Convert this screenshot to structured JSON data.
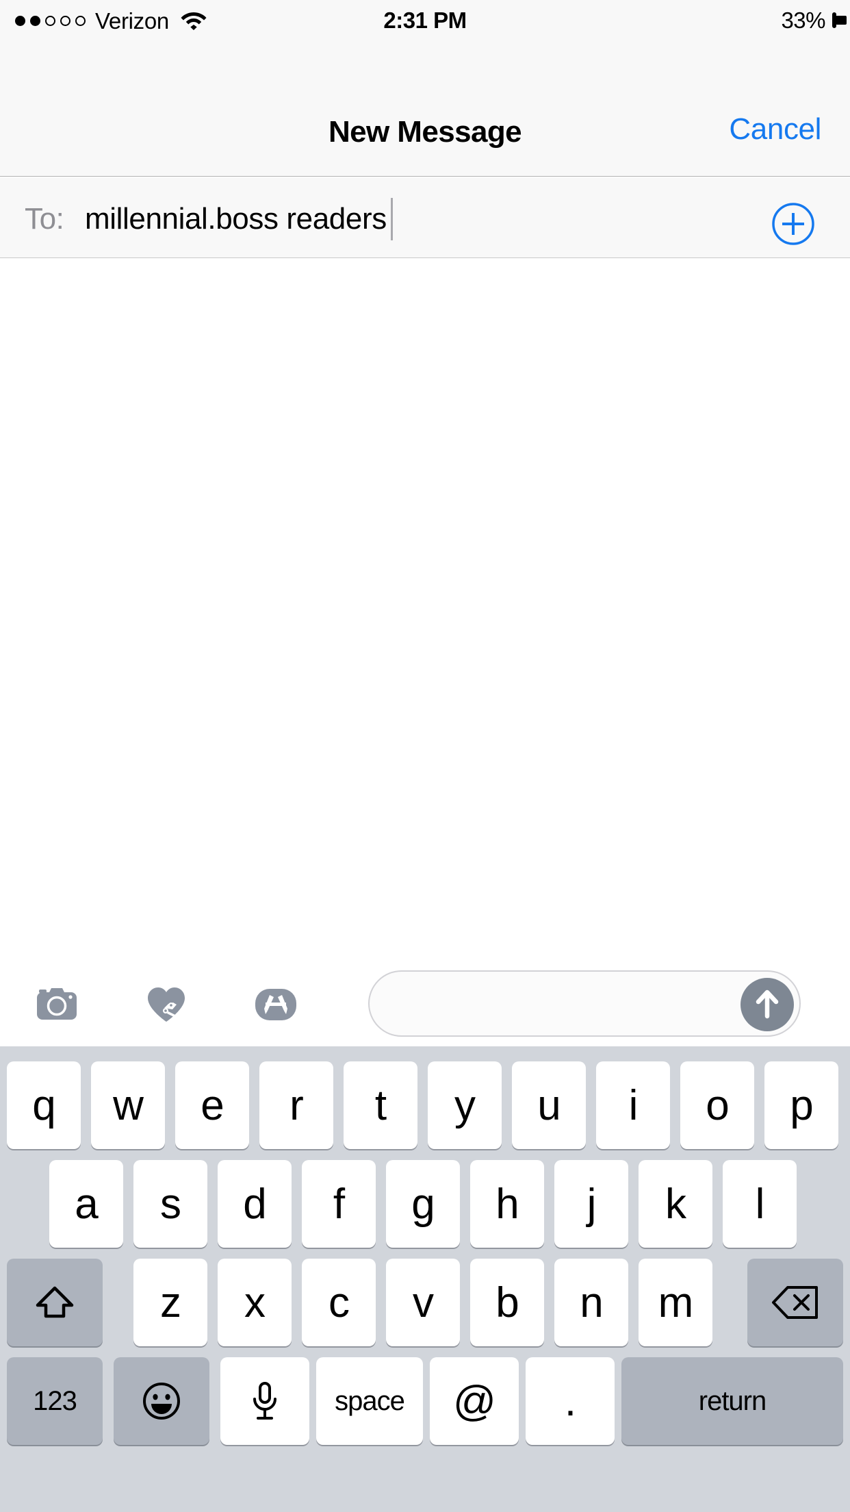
{
  "status_bar": {
    "signal_dots_filled": 2,
    "signal_dots_total": 5,
    "carrier": "Verizon",
    "wifi_icon": "wifi-icon",
    "time": "2:31 PM",
    "battery_percent_label": "33%",
    "battery_level": 33,
    "battery_icon": "battery-icon"
  },
  "nav_bar": {
    "title": "New Message",
    "cancel_label": "Cancel"
  },
  "to_field": {
    "label": "To:",
    "value": "millennial.boss readers",
    "add_contact_icon": "plus-circle-icon"
  },
  "toolbar": {
    "camera_icon": "camera-icon",
    "digital_touch_icon": "heart-hand-icon",
    "app_store_icon": "app-store-icon",
    "send_icon": "arrow-up-icon",
    "message_placeholder": "",
    "message_value": ""
  },
  "keyboard": {
    "row1": [
      "q",
      "w",
      "e",
      "r",
      "t",
      "y",
      "u",
      "i",
      "o",
      "p"
    ],
    "row2": [
      "a",
      "s",
      "d",
      "f",
      "g",
      "h",
      "j",
      "k",
      "l"
    ],
    "row3": [
      "z",
      "x",
      "c",
      "v",
      "b",
      "n",
      "m"
    ],
    "shift_icon": "shift-arrow-icon",
    "backspace_icon": "backspace-delete-icon",
    "numeric_label": "123",
    "emoji_icon": "smiley-face-icon",
    "dictation_icon": "microphone-icon",
    "space_label": "space",
    "at_label": "@",
    "period_label": ".",
    "return_label": "return"
  },
  "colors": {
    "accent_blue": "#1579ef",
    "bar_background": "#f8f8f8",
    "keyboard_background": "#d1d5db",
    "key_white": "#ffffff",
    "key_gray": "#adb3bd",
    "icon_gray": "#8b93a0",
    "send_gray": "#7e8793",
    "to_label_gray": "#8e8e93"
  }
}
